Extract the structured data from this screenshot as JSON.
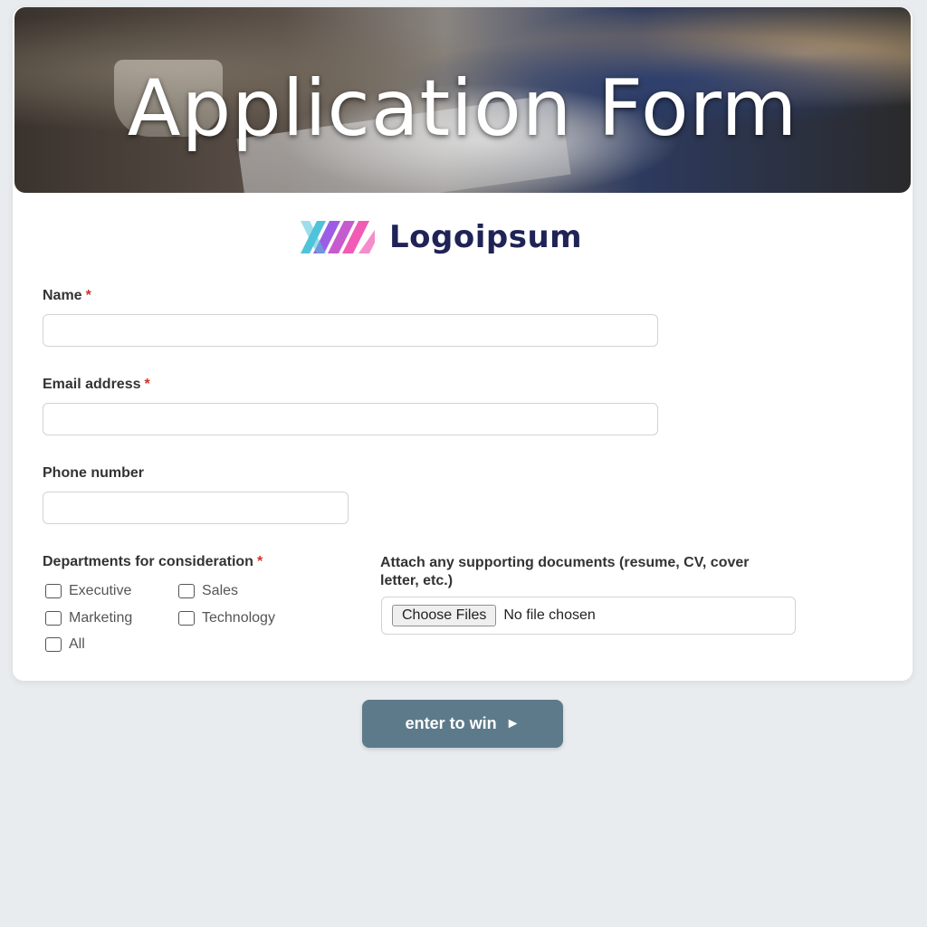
{
  "header": {
    "title": "Application Form"
  },
  "logo": {
    "text": "Logoipsum",
    "colors": [
      "#4fc3d9",
      "#9b5de5",
      "#f15bb5"
    ]
  },
  "fields": {
    "name": {
      "label": "Name",
      "required_mark": "*",
      "value": "",
      "placeholder": ""
    },
    "email": {
      "label": "Email address",
      "required_mark": "*",
      "value": "",
      "placeholder": ""
    },
    "phone": {
      "label": "Phone number",
      "value": "",
      "placeholder": ""
    }
  },
  "departments": {
    "label": "Departments for consideration",
    "required_mark": "*",
    "options": [
      {
        "label": "Executive",
        "checked": false
      },
      {
        "label": "Sales",
        "checked": false
      },
      {
        "label": "Marketing",
        "checked": false
      },
      {
        "label": "Technology",
        "checked": false
      },
      {
        "label": "All",
        "checked": false
      }
    ]
  },
  "attachments": {
    "label": "Attach any supporting documents (resume, CV, cover letter, etc.)",
    "button_label": "Choose Files",
    "status": "No file chosen"
  },
  "submit": {
    "label": "enter to win",
    "arrow": "►",
    "color": "#5d7a8a"
  }
}
